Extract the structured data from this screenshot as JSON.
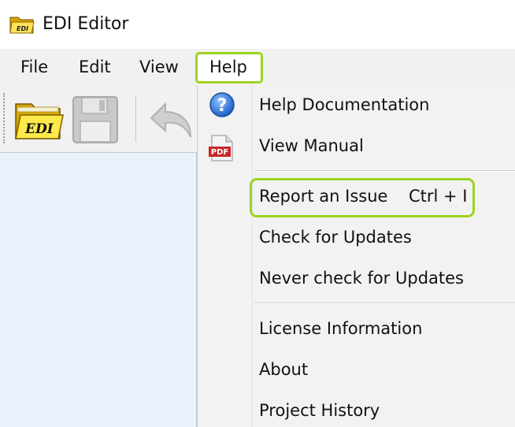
{
  "window": {
    "title": "EDI Editor",
    "icon": "edi-folder-icon"
  },
  "menubar": {
    "items": [
      {
        "label": "File"
      },
      {
        "label": "Edit"
      },
      {
        "label": "View"
      },
      {
        "label": "Help"
      }
    ],
    "active": "Help"
  },
  "toolbar": {
    "buttons": [
      {
        "name": "open-edi",
        "icon": "edi-open-folder-icon",
        "badge": "EDI"
      },
      {
        "name": "save",
        "icon": "save-disk-icon",
        "state": "disabled"
      },
      {
        "name": "undo",
        "icon": "undo-arrow-icon",
        "state": "disabled"
      }
    ]
  },
  "help_menu": {
    "items": [
      {
        "label": "Help Documentation",
        "icon": "help-question-icon"
      },
      {
        "label": "View Manual",
        "icon": "pdf-icon",
        "icon_text": "PDF"
      },
      {
        "label": "Report an Issue",
        "shortcut": "Ctrl + I",
        "highlighted": true
      },
      {
        "label": "Check for Updates"
      },
      {
        "label": "Never check for Updates"
      },
      {
        "label": "License Information"
      },
      {
        "label": "About"
      },
      {
        "label": "Project History"
      }
    ]
  },
  "colors": {
    "highlight_outline": "#9ed321",
    "menubar_bg": "#f1f1f1",
    "editor_bg": "#ebf1fb"
  }
}
